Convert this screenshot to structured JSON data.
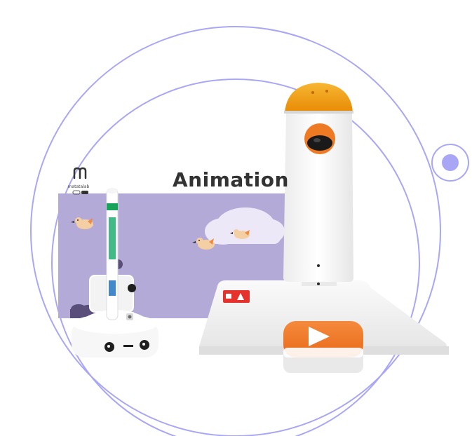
{
  "scene": {
    "title": "Animation",
    "brand_name": "matatalab",
    "colors": {
      "orbit": "#a9a7f5",
      "panel": "#b3aad8",
      "orange": "#f07522",
      "amber_dome": "#f29a0c",
      "white": "#ffffff",
      "red_tile": "#e5322d"
    },
    "icons": [
      "brand-logo-icon",
      "play-icon",
      "marker-pen",
      "bird-icon",
      "cloud-icon"
    ]
  }
}
